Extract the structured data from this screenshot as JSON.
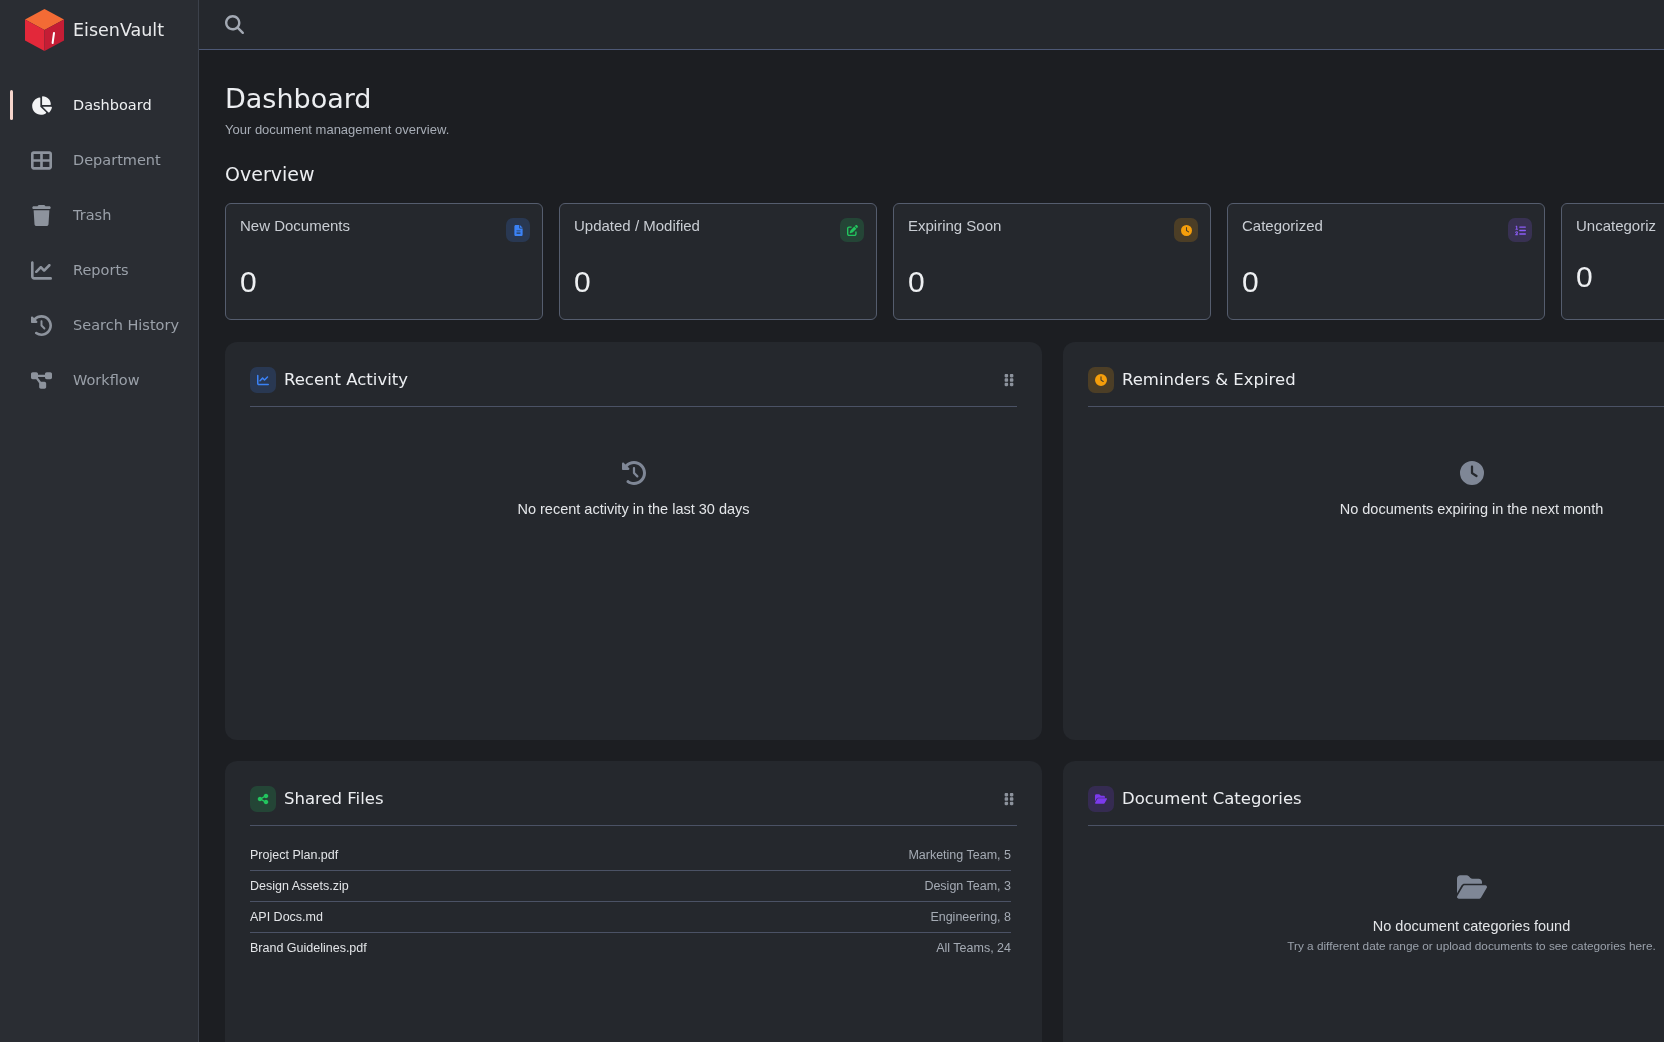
{
  "sidebar": {
    "brand": "EisenVault",
    "items": [
      {
        "label": "Dashboard",
        "selected": true
      },
      {
        "label": "Department",
        "selected": false
      },
      {
        "label": "Trash",
        "selected": false
      },
      {
        "label": "Reports",
        "selected": false
      },
      {
        "label": "Search History",
        "selected": false
      },
      {
        "label": "Workflow",
        "selected": false
      }
    ]
  },
  "header": {
    "title": "Dashboard",
    "subtitle": "Your document management overview."
  },
  "overview": {
    "title": "Overview",
    "cards": [
      {
        "label": "New Documents",
        "value": "0",
        "color": "#3b82f6"
      },
      {
        "label": "Updated / Modified",
        "value": "0",
        "color": "#22c55e"
      },
      {
        "label": "Expiring Soon",
        "value": "0",
        "color": "#f59e0b"
      },
      {
        "label": "Categorized",
        "value": "0",
        "color": "#8b5cf6"
      },
      {
        "label": "Uncategoriz",
        "value": "0"
      }
    ]
  },
  "panels": [
    {
      "title": "Recent Activity",
      "color": "#3b82f6",
      "grip": true,
      "empty": {
        "message": "No recent activity in the last 30 days"
      }
    },
    {
      "title": "Reminders & Expired",
      "color": "#f59e0b",
      "empty": {
        "message": "No documents expiring in the next month"
      }
    },
    {
      "title": "Shared Files",
      "color": "#22c55e",
      "grip": true,
      "rows": [
        {
          "name": "Project Plan.pdf",
          "detail": "Marketing Team, 5"
        },
        {
          "name": "Design Assets.zip",
          "detail": "Design Team, 3"
        },
        {
          "name": "API Docs.md",
          "detail": "Engineering, 8"
        },
        {
          "name": "Brand Guidelines.pdf",
          "detail": "All Teams, 24"
        }
      ]
    },
    {
      "title": "Document Categories",
      "color": "#7c3aed",
      "empty": {
        "message": "No document categories found",
        "hint": "Try a different date range or upload documents to see categories here."
      }
    }
  ]
}
